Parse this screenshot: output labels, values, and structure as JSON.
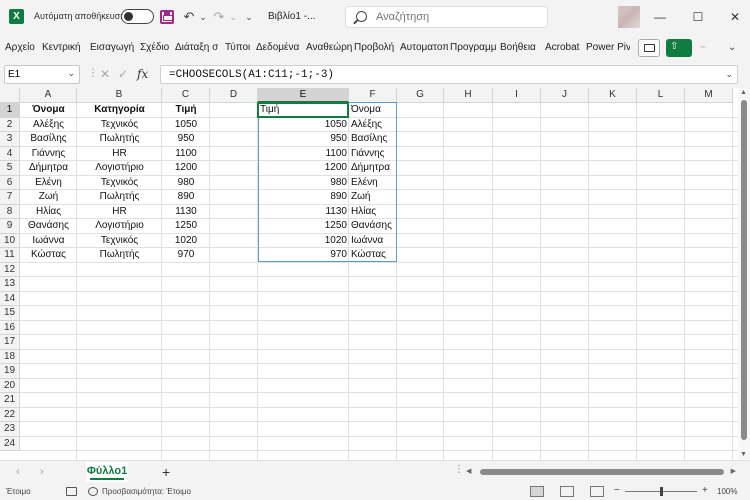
{
  "titlebar": {
    "app_icon": "X",
    "autosave_label": "Αυτόματη αποθήκευση",
    "doc_title": "Βιβλίο1  -...",
    "search_placeholder": "Αναζήτηση",
    "undo_icon": "↶",
    "redo_icon": "↷",
    "dropdown_icon": "⌄",
    "minimize_icon": "—",
    "maximize_icon": "☐",
    "close_icon": "✕"
  },
  "ribbon": {
    "tabs": [
      "Αρχείο",
      "Κεντρική",
      "Εισαγωγή",
      "Σχέδιο",
      "Διάταξη σ",
      "Τύποι",
      "Δεδομένα",
      "Αναθεώρη",
      "Προβολή",
      "Αυτοματοπ",
      "Προγραμμ",
      "Βοήθεια",
      "Acrobat",
      "Power Pivot"
    ],
    "share_icon": "⇧",
    "chevron_icon": "⌄",
    "dim_icon": "⌁"
  },
  "formula_bar": {
    "name_box": "E1",
    "formula": "=CHOOSECOLS(A1:C11;-1;-3)",
    "sep_icon": "⋮",
    "cancel_icon": "✕",
    "enter_icon": "✓",
    "fx_icon": "fx",
    "dd_icon": "⌄"
  },
  "grid": {
    "columns": [
      "A",
      "B",
      "C",
      "D",
      "E",
      "F",
      "G",
      "H",
      "I",
      "J",
      "K",
      "L",
      "M"
    ],
    "rows": [
      "1",
      "2",
      "3",
      "4",
      "5",
      "6",
      "7",
      "8",
      "9",
      "10",
      "11",
      "12",
      "13",
      "14",
      "15",
      "16",
      "17",
      "18",
      "19",
      "20",
      "21",
      "22",
      "23",
      "24"
    ],
    "headers": {
      "A1": "Όνομα",
      "B1": "Κατηγορία",
      "C1": "Τιμή"
    },
    "source_rows": [
      {
        "name": "Αλέξης",
        "category": "Τεχνικός",
        "price": "1050"
      },
      {
        "name": "Βασίλης",
        "category": "Πωλητής",
        "price": "950"
      },
      {
        "name": "Γιάννης",
        "category": "HR",
        "price": "1100"
      },
      {
        "name": "Δήμητρα",
        "category": "Λογιστήριο",
        "price": "1200"
      },
      {
        "name": "Ελένη",
        "category": "Τεχνικός",
        "price": "980"
      },
      {
        "name": "Ζωή",
        "category": "Πωλητής",
        "price": "890"
      },
      {
        "name": "Ηλίας",
        "category": "HR",
        "price": "1130"
      },
      {
        "name": "Θανάσης",
        "category": "Λογιστήριο",
        "price": "1250"
      },
      {
        "name": "Ιωάννα",
        "category": "Τεχνικός",
        "price": "1020"
      },
      {
        "name": "Κώστας",
        "category": "Πωλητής",
        "price": "970"
      }
    ],
    "spill_headers": {
      "E1": "Τιμή",
      "F1": "Όνομα"
    },
    "spill_rows": [
      {
        "price": "1050",
        "name": "Αλέξης"
      },
      {
        "price": "950",
        "name": "Βασίλης"
      },
      {
        "price": "1100",
        "name": "Γιάννης"
      },
      {
        "price": "1200",
        "name": "Δήμητρα"
      },
      {
        "price": "980",
        "name": "Ελένη"
      },
      {
        "price": "890",
        "name": "Ζωή"
      },
      {
        "price": "1130",
        "name": "Ηλίας"
      },
      {
        "price": "1250",
        "name": "Θανάσης"
      },
      {
        "price": "1020",
        "name": "Ιωάννα"
      },
      {
        "price": "970",
        "name": "Κώστας"
      }
    ]
  },
  "sheet_bar": {
    "prev_icon": "‹",
    "next_icon": "›",
    "sheet_name": "Φύλλο1",
    "add_icon": "+",
    "dots_icon": "⋮"
  },
  "status_bar": {
    "ready": "Έτοιμο",
    "accessibility": "Προσβασιμότητα: Έτοιμο",
    "zoom_minus": "−",
    "zoom_plus": "+",
    "zoom_level": "100%",
    "zoom_fraction": 0.5
  },
  "colors": {
    "accent": "#107c41",
    "spill_border": "#5b9bd5",
    "save_icon": "#9b2a8a"
  }
}
